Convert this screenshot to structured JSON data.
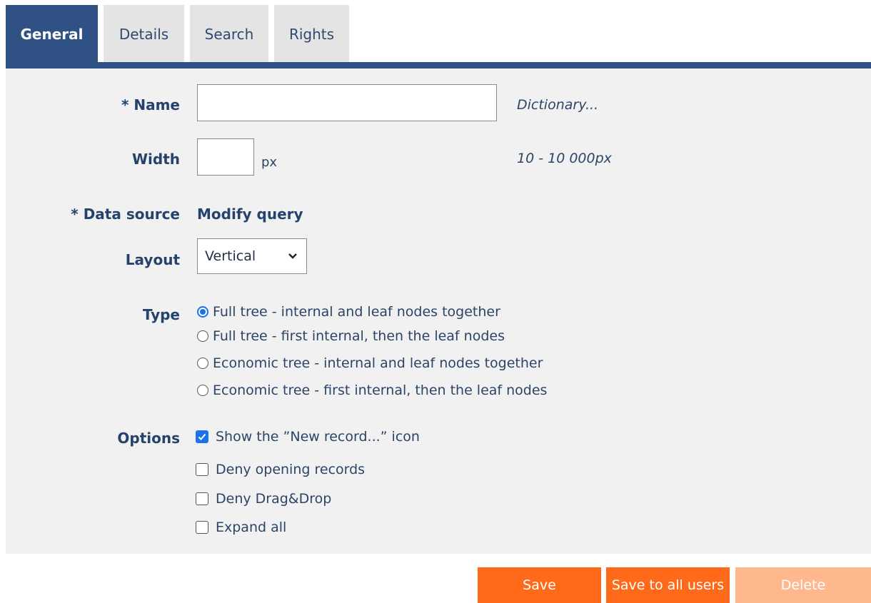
{
  "tabs": [
    {
      "label": "General",
      "active": true
    },
    {
      "label": "Details",
      "active": false
    },
    {
      "label": "Search",
      "active": false
    },
    {
      "label": "Rights",
      "active": false
    }
  ],
  "form": {
    "name": {
      "label": "* Name",
      "value": "",
      "hint": "Dictionary..."
    },
    "width": {
      "label": "Width",
      "value": "",
      "unit": "px",
      "hint": "10 - 10 000px"
    },
    "data_source": {
      "label": "* Data source",
      "link": "Modify query"
    },
    "layout": {
      "label": "Layout",
      "selected": "Vertical"
    },
    "type": {
      "label": "Type",
      "options": [
        {
          "text": "Full tree - internal and leaf nodes together",
          "checked": true
        },
        {
          "text": "Full tree - first internal, then the leaf nodes",
          "checked": false
        },
        {
          "text": "Economic tree - internal and leaf nodes together",
          "checked": false
        },
        {
          "text": "Economic tree - first internal, then the leaf nodes",
          "checked": false
        }
      ]
    },
    "options": {
      "label": "Options",
      "items": [
        {
          "text": "Show the ”New record...” icon",
          "checked": true
        },
        {
          "text": "Deny opening records",
          "checked": false
        },
        {
          "text": "Deny Drag&Drop",
          "checked": false
        },
        {
          "text": "Expand all",
          "checked": false
        }
      ]
    }
  },
  "buttons": {
    "save": "Save",
    "save_all": "Save to all users",
    "delete": "Delete"
  },
  "colors": {
    "primary": "#2f5183",
    "accent": "#ff6a1a",
    "accent_disabled": "#ffb78d",
    "panel": "#f1f1f1"
  }
}
